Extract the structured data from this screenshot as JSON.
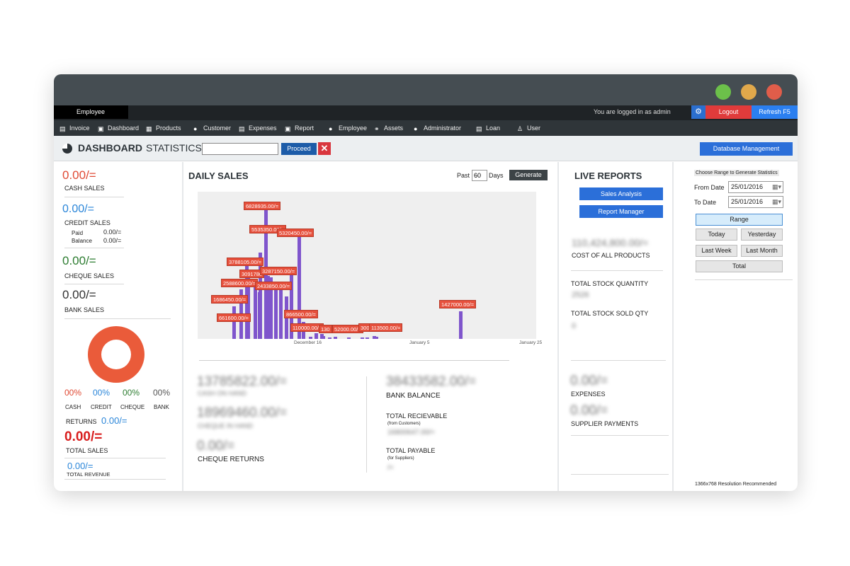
{
  "window": {
    "title": ""
  },
  "colors": {
    "dot_green": "#6cc04a",
    "dot_yellow": "#e0a84b",
    "dot_red": "#e05d4a",
    "accent_blue": "#2b6fd9",
    "cash_red": "#e04a34",
    "credit_blue": "#2b86d9",
    "cheque_green": "#2e7d32"
  },
  "topbar": {
    "user_label": "Employee",
    "logged_in": "You are logged in as admin",
    "logout": "Logout",
    "refresh": "Refresh F5",
    "settings_icon": "gear-icon"
  },
  "menu": [
    {
      "label": "Invoice",
      "icon": "invoice-icon"
    },
    {
      "label": "Dashboard",
      "icon": "dashboard-icon"
    },
    {
      "label": "Products",
      "icon": "cart-icon"
    },
    {
      "label": "Customer",
      "icon": "users-icon"
    },
    {
      "label": "Expenses",
      "icon": "expenses-icon"
    },
    {
      "label": "Report",
      "icon": "report-icon"
    },
    {
      "label": "Employee",
      "icon": "employee-icon"
    },
    {
      "label": "Assets",
      "icon": "assets-icon"
    },
    {
      "label": "Administrator",
      "icon": "admin-icon"
    },
    {
      "label": "Loan",
      "icon": "loan-icon"
    },
    {
      "label": "User",
      "icon": "user-icon"
    }
  ],
  "header": {
    "title": "DASHBOARD",
    "statistics": "STATISTICS",
    "input_value": "",
    "proceed": "Proceed",
    "database_management": "Database Management"
  },
  "left": {
    "cash_sales_value": "0.00/=",
    "cash_sales_label": "CASH SALES",
    "credit_sales_value": "0.00/=",
    "credit_sales_label": "CREDIT SALES",
    "paid_label": "Paid",
    "paid_value": "0.00/=",
    "balance_label": "Balance",
    "balance_value": "0.00/=",
    "cheque_sales_value": "0.00/=",
    "cheque_sales_label": "CHEQUE SALES",
    "bank_sales_value": "0.00/=",
    "bank_sales_label": "BANK SALES",
    "pct": [
      {
        "value": "00%",
        "label": "CASH"
      },
      {
        "value": "00%",
        "label": "CREDIT"
      },
      {
        "value": "00%",
        "label": "CHEQUE"
      },
      {
        "value": "00%",
        "label": "BANK"
      }
    ],
    "returns_label": "RETURNS",
    "returns_value": "0.00/=",
    "total_sales_value": "0.00/=",
    "total_sales_label": "TOTAL SALES",
    "total_revenue_value": "0.00/=",
    "total_revenue_label": "TOTAL REVENUE"
  },
  "daily": {
    "title": "DAILY SALES",
    "past_label": "Past",
    "days_value": "60",
    "days_label": "Days",
    "generate": "Generate",
    "cash_on_hand_value": "13785822.00/=",
    "cash_on_hand_label": "CASH ON HAND",
    "cheque_in_hand_value": "18969460.00/=",
    "cheque_in_hand_label": "CHEQUE IN HAND",
    "cheque_returns_value": "0.00/=",
    "cheque_returns_label": "CHEQUE RETURNS",
    "bank_balance_value": "38433582.00/=",
    "bank_balance_label": "BANK BALANCE",
    "total_receivable_label": "TOTAL RECIEVABLE",
    "from_customers": "(from Customers)",
    "total_receivable_value": "16800647.00/=",
    "total_payable_label": "TOTAL PAYABLE",
    "for_suppliers": "(for Suppliers)",
    "total_payable_value": "/="
  },
  "chart_data": {
    "type": "bar",
    "title": "",
    "xlabel": "",
    "ylabel": "",
    "x_ticks": [
      "December 16",
      "January 5",
      "January 25"
    ],
    "labels": [
      "6828935.00/=",
      "5535350.00/=",
      "5320450.00/=",
      "3788105.00/=",
      "3091780",
      "3287150.00/=",
      "2588600.00/=",
      "2433850.00/=",
      "1686450.00/=",
      "661600.00/=",
      "866500.00/=",
      "110000.00/=",
      "130",
      "52000.00/=",
      "300",
      "113500.00/=",
      "1427000.00/="
    ],
    "values": [
      6828935,
      5535350,
      5320450,
      3788105,
      3091780,
      3287150,
      2588600,
      2433850,
      1686450,
      661600,
      866500,
      110000,
      130000,
      52000,
      30000,
      113500,
      1427000
    ],
    "ylim": [
      0,
      7500000
    ]
  },
  "live": {
    "title": "LIVE REPORTS",
    "sales_analysis": "Sales Analysis",
    "report_manager": "Report Manager",
    "cost_value": "110,424,800.00/=",
    "cost_label": "COST OF ALL PRODUCTS",
    "stock_qty_label": "TOTAL STOCK QUANTITY",
    "stock_qty_value": "2526",
    "stock_sold_label": "TOTAL STOCK SOLD QTY",
    "stock_sold_value": "0",
    "expenses_value": "0.00/=",
    "expenses_label": "EXPENSES",
    "supplier_value": "0.00/=",
    "supplier_label": "SUPPLIER PAYMENTS"
  },
  "range": {
    "title": "Choose Range to Generate Statistics",
    "from_label": "From Date",
    "from_value": "25/01/2016",
    "to_label": "To Date",
    "to_value": "25/01/2016",
    "range_btn": "Range",
    "today": "Today",
    "yesterday": "Yesterday",
    "last_week": "Last Week",
    "last_month": "Last Month",
    "total": "Total",
    "resolution": "1366x768 Resolution Recommended"
  }
}
